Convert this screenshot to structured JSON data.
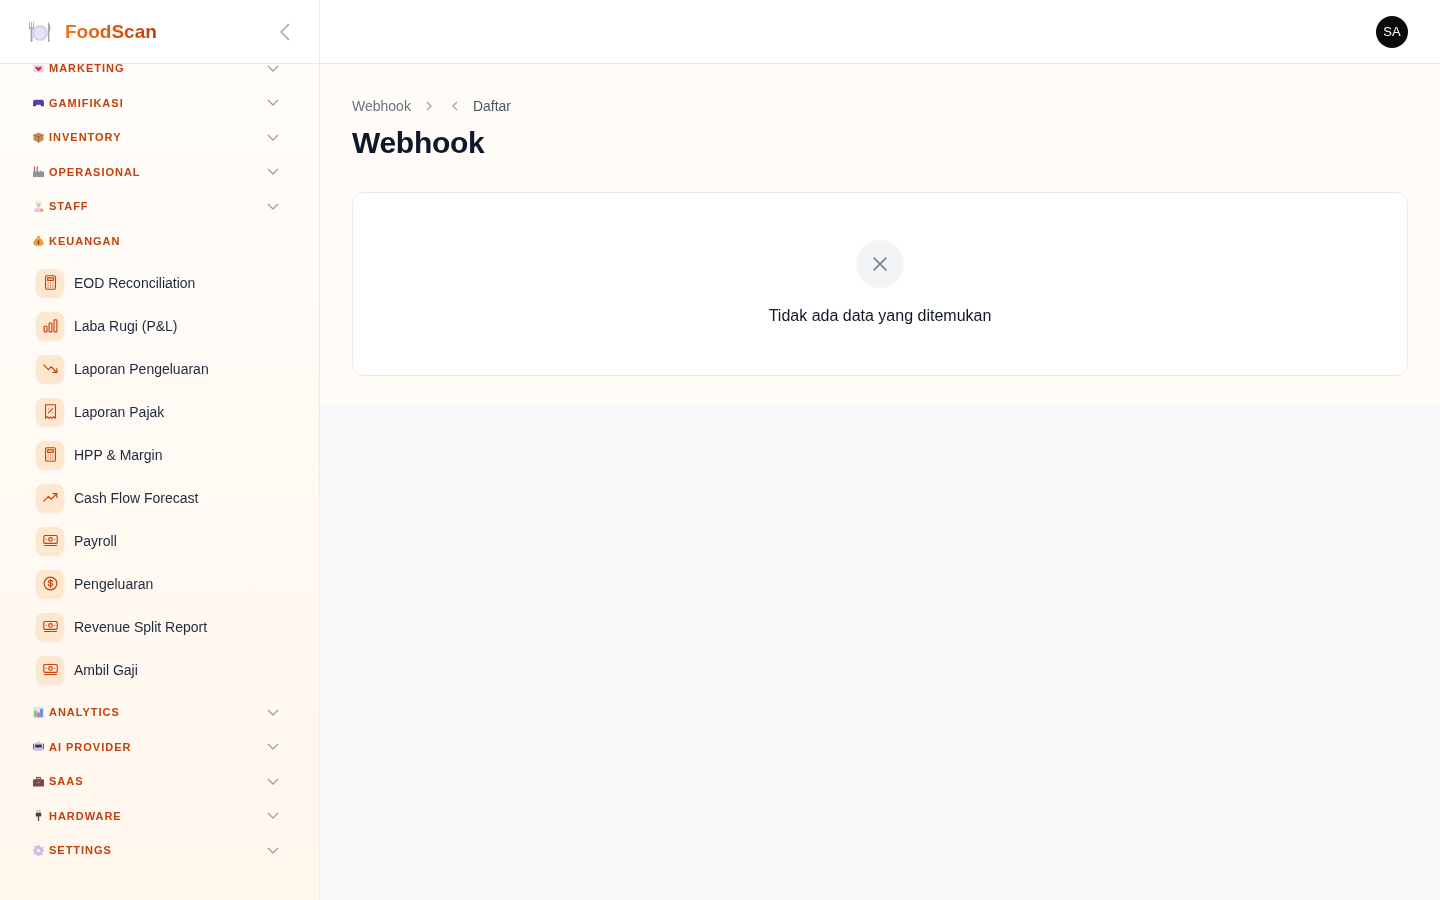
{
  "sidebar": {
    "brand": "FoodScan",
    "sections": [
      {
        "label": "MARKETING",
        "expanded": false
      },
      {
        "label": "GAMIFIKASI",
        "expanded": false
      },
      {
        "label": "INVENTORY",
        "expanded": false
      },
      {
        "label": "OPERASIONAL",
        "expanded": false
      },
      {
        "label": "STAFF",
        "expanded": false
      },
      {
        "label": "KEUANGAN",
        "expanded": true,
        "items": [
          {
            "label": "EOD Reconciliation",
            "selected": false
          },
          {
            "label": "Laba Rugi (P&L)",
            "selected": false
          },
          {
            "label": "Laporan Pengeluaran",
            "selected": false
          },
          {
            "label": "Laporan Pajak",
            "selected": false
          },
          {
            "label": "HPP & Margin",
            "selected": false
          },
          {
            "label": "Cash Flow Forecast",
            "selected": false
          },
          {
            "label": "Payroll",
            "selected": false
          },
          {
            "label": "Pengeluaran",
            "selected": false
          },
          {
            "label": "Revenue Split Report",
            "selected": false
          },
          {
            "label": "Ambil Gaji",
            "selected": false
          }
        ]
      },
      {
        "label": "ANALYTICS",
        "expanded": false
      },
      {
        "label": "AI PROVIDER",
        "expanded": false
      },
      {
        "label": "SAAS",
        "expanded": false
      },
      {
        "label": "HARDWARE",
        "expanded": false
      },
      {
        "label": "SETTINGS",
        "expanded": false
      }
    ]
  },
  "topbar": {
    "avatar": "SA"
  },
  "breadcrumb": [
    {
      "label": "Webhook"
    },
    {
      "label": "Daftar"
    }
  ],
  "page": {
    "title": "Webhook"
  },
  "empty_state": {
    "message": "Tidak ada data yang ditemukan"
  }
}
